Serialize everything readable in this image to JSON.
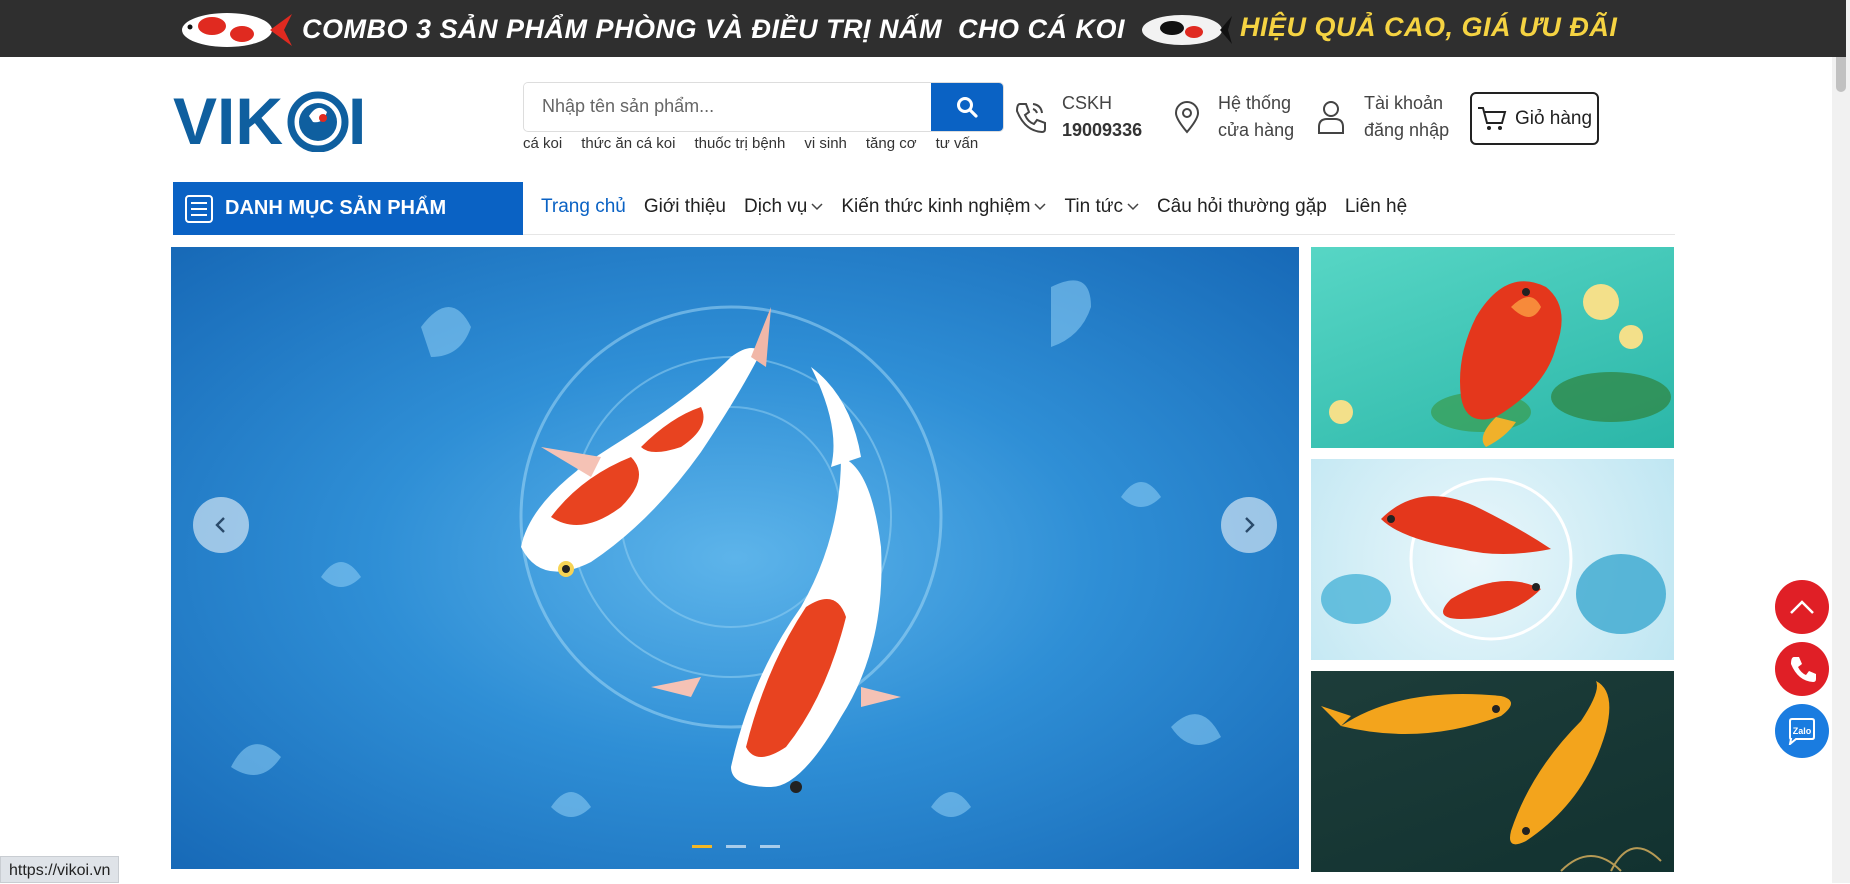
{
  "promo": {
    "text_main": "COMBO 3 SẢN PHẨM PHÒNG VÀ ĐIỀU TRỊ NẤM",
    "text_for": "CHO CÁ KOI",
    "text_highlight": "HIỆU QUẢ CAO, GIÁ ƯU ĐÃI"
  },
  "logo": {
    "text": "VIKOI"
  },
  "search": {
    "placeholder": "Nhập tên sản phẩm...",
    "tags": [
      "cá koi",
      "thức ăn cá koi",
      "thuốc trị bệnh",
      "vi sinh",
      "tăng cơ",
      "tư vấn"
    ]
  },
  "header": {
    "support_label": "CSKH",
    "support_phone": "19009336",
    "stores_line1": "Hệ thống",
    "stores_line2": "cửa hàng",
    "account_line1": "Tài khoản",
    "account_line2": "đăng nhập",
    "cart_label": "Giỏ hàng"
  },
  "nav": {
    "category_label": "DANH MỤC SẢN PHẨM",
    "items": [
      {
        "label": "Trang chủ"
      },
      {
        "label": "Giới thiệu"
      },
      {
        "label": "Dịch vụ"
      },
      {
        "label": "Kiến thức kinh nghiệm"
      },
      {
        "label": "Tin tức"
      },
      {
        "label": "Câu hỏi thường gặp"
      },
      {
        "label": "Liên hệ"
      }
    ]
  },
  "slider": {
    "slide_count": 3,
    "active_slide": 1
  },
  "floating": {
    "zalo_label": "Zalo"
  },
  "status_bar": {
    "url": "https://vikoi.vn"
  },
  "colors": {
    "brand_blue": "#0a62c4",
    "promo_bg": "#2f2f2f",
    "highlight_yellow": "#f5d342",
    "float_red": "#e01f26"
  }
}
